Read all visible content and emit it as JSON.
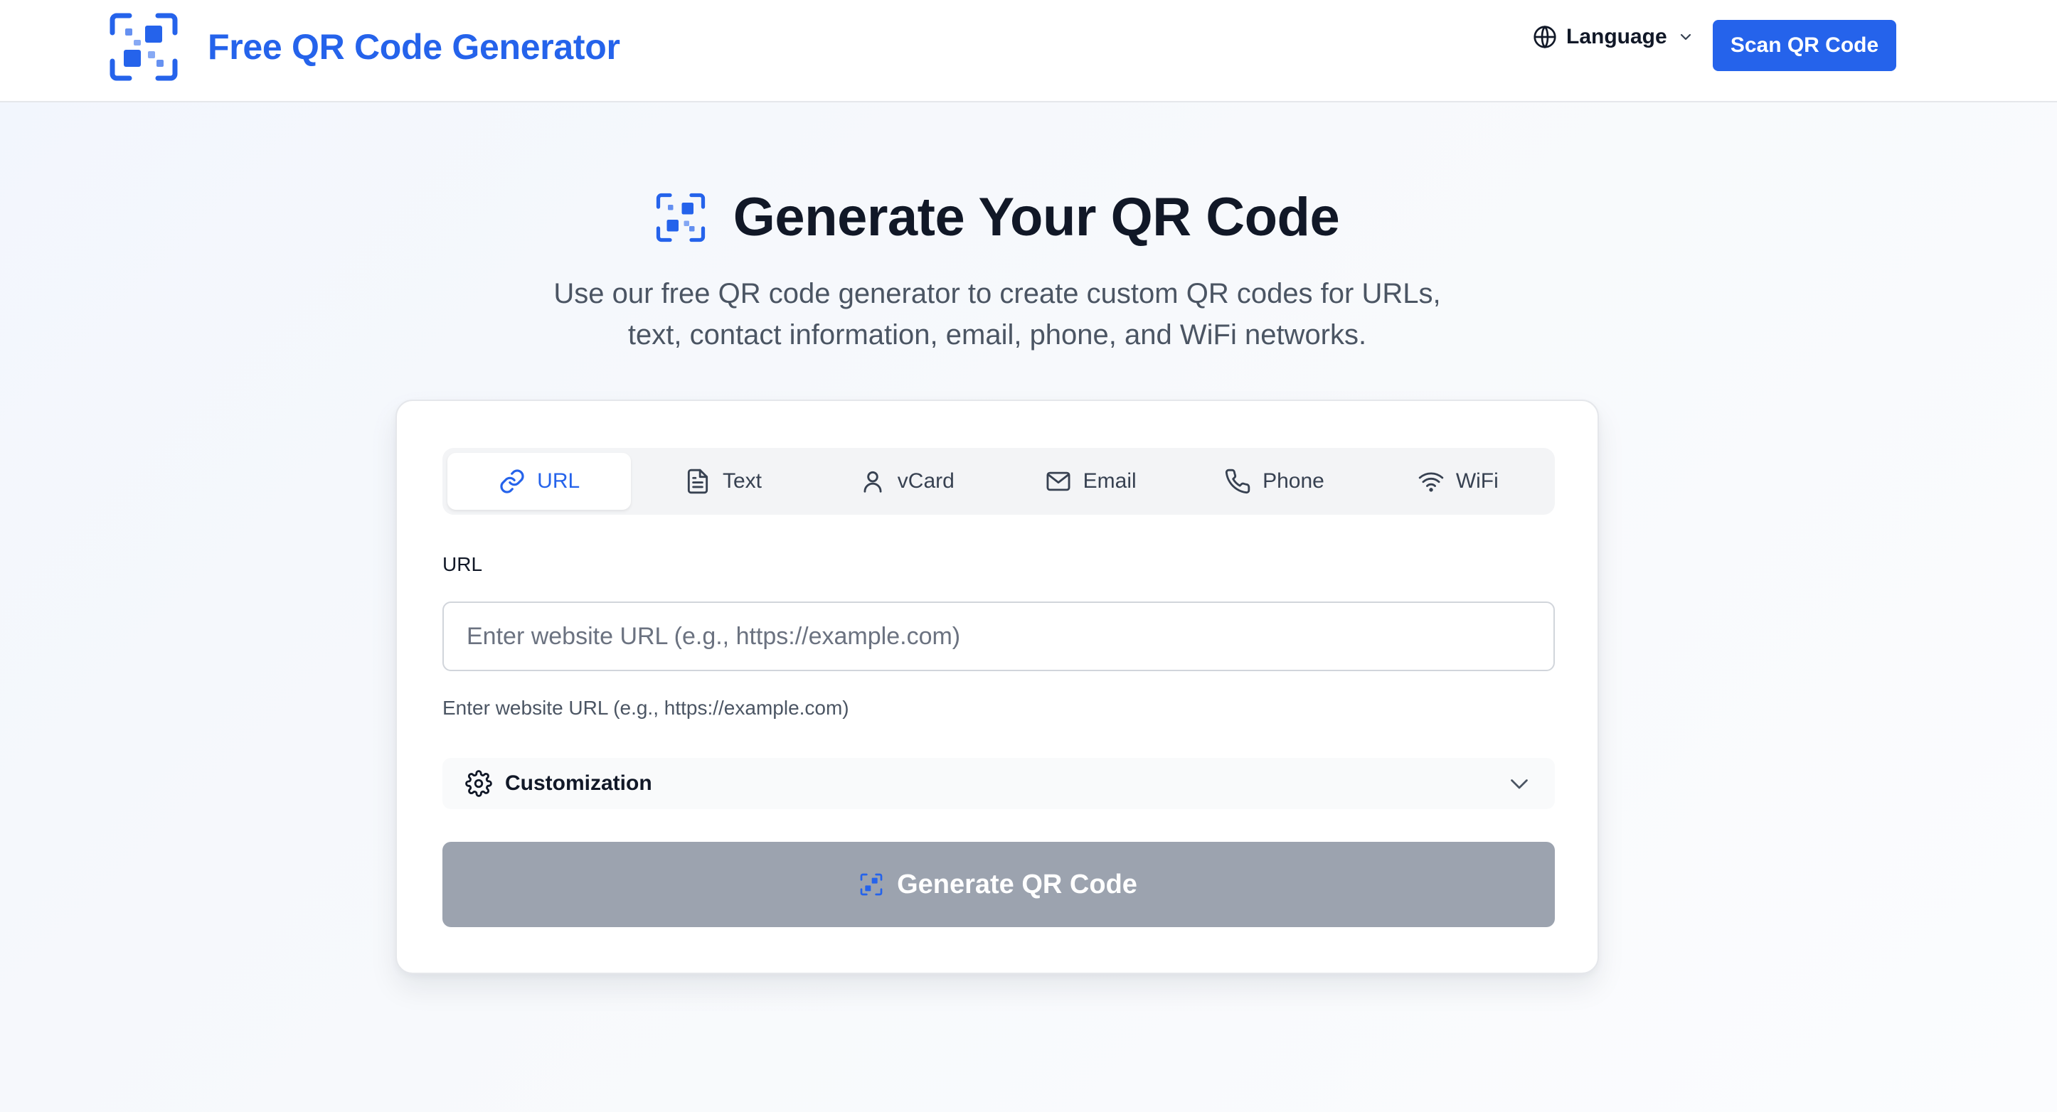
{
  "header": {
    "brand_name": "Free QR Code Generator",
    "language_label": "Language",
    "scan_button": "Scan QR Code"
  },
  "hero": {
    "title": "Generate Your QR Code",
    "subtitle_line1": "Use our free QR code generator to create custom QR codes for URLs,",
    "subtitle_line2": "text, contact information, email, phone, and WiFi networks."
  },
  "tabs": [
    {
      "label": "URL",
      "icon": "link-icon",
      "active": true
    },
    {
      "label": "Text",
      "icon": "document-icon",
      "active": false
    },
    {
      "label": "vCard",
      "icon": "user-icon",
      "active": false
    },
    {
      "label": "Email",
      "icon": "mail-icon",
      "active": false
    },
    {
      "label": "Phone",
      "icon": "phone-icon",
      "active": false
    },
    {
      "label": "WiFi",
      "icon": "wifi-icon",
      "active": false
    }
  ],
  "form": {
    "field_label": "URL",
    "input_value": "",
    "input_placeholder": "Enter website URL (e.g., https://example.com)",
    "hint": "Enter website URL (e.g., https://example.com)",
    "customization_label": "Customization",
    "generate_button": "Generate QR Code"
  },
  "colors": {
    "accent": "#2563eb",
    "disabled_button": "#9ca3af",
    "text_primary": "#111827",
    "text_secondary": "#4b5563"
  }
}
